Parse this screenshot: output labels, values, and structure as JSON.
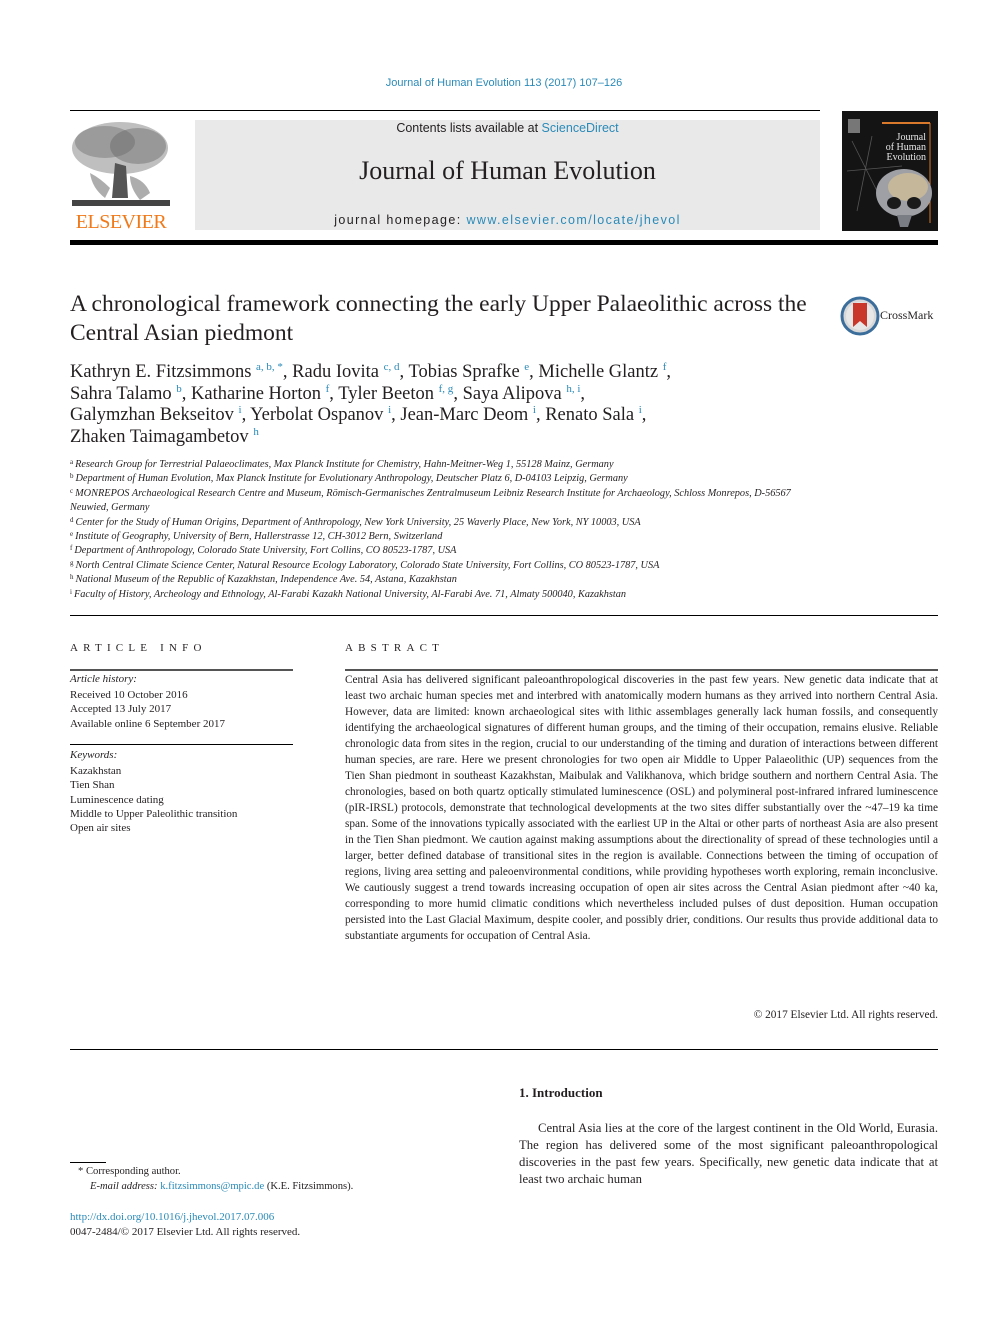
{
  "header": {
    "running_head": "Journal of Human Evolution 113 (2017) 107–126",
    "contents_prefix": "Contents lists available at ",
    "contents_link": "ScienceDirect",
    "journal_title": "Journal of Human Evolution",
    "homepage_prefix": "journal homepage: ",
    "homepage_link": "www.elsevier.com/locate/jhevol",
    "publisher_logo_text": "ELSEVIER",
    "cover_title_lines": [
      "Journal",
      "of Human",
      "Evolution"
    ],
    "colors": {
      "link": "#2a8ab8",
      "publisher": "#f07a1a",
      "masthead_bg": "#e9e9e9"
    }
  },
  "article": {
    "title": "A chronological framework connecting the early Upper Palaeolithic across the Central Asian piedmont",
    "crossmark_label": "CrossMark",
    "authors": [
      {
        "name": "Kathryn E. Fitzsimmons",
        "aff": "a, b, *",
        "sep": ", "
      },
      {
        "name": "Radu Iovita",
        "aff": "c, d",
        "sep": ", "
      },
      {
        "name": "Tobias Sprafke",
        "aff": "e",
        "sep": ", "
      },
      {
        "name": "Michelle Glantz",
        "aff": "f",
        "sep": ","
      },
      {
        "name": "Sahra Talamo",
        "aff": "b",
        "sep": ", "
      },
      {
        "name": "Katharine Horton",
        "aff": "f",
        "sep": ", "
      },
      {
        "name": "Tyler Beeton",
        "aff": "f, g",
        "sep": ", "
      },
      {
        "name": "Saya Alipova",
        "aff": "h, i",
        "sep": ","
      },
      {
        "name": "Galymzhan Bekseitov",
        "aff": "i",
        "sep": ", "
      },
      {
        "name": "Yerbolat Ospanov",
        "aff": "i",
        "sep": ", "
      },
      {
        "name": "Jean-Marc Deom",
        "aff": "i",
        "sep": ", "
      },
      {
        "name": "Renato Sala",
        "aff": "i",
        "sep": ","
      },
      {
        "name": "Zhaken Taimagambetov",
        "aff": "h",
        "sep": ""
      }
    ],
    "affiliations": [
      {
        "key": "a",
        "text": "Research Group for Terrestrial Palaeoclimates, Max Planck Institute for Chemistry, Hahn-Meitner-Weg 1, 55128 Mainz, Germany"
      },
      {
        "key": "b",
        "text": "Department of Human Evolution, Max Planck Institute for Evolutionary Anthropology, Deutscher Platz 6, D-04103 Leipzig, Germany"
      },
      {
        "key": "c",
        "text": "MONREPOS Archaeological Research Centre and Museum, Römisch-Germanisches Zentralmuseum Leibniz Research Institute for Archaeology, Schloss Monrepos, D-56567 Neuwied, Germany"
      },
      {
        "key": "d",
        "text": "Center for the Study of Human Origins, Department of Anthropology, New York University, 25 Waverly Place, New York, NY 10003, USA"
      },
      {
        "key": "e",
        "text": "Institute of Geography, University of Bern, Hallerstrasse 12, CH-3012 Bern, Switzerland"
      },
      {
        "key": "f",
        "text": "Department of Anthropology, Colorado State University, Fort Collins, CO 80523-1787, USA"
      },
      {
        "key": "g",
        "text": "North Central Climate Science Center, Natural Resource Ecology Laboratory, Colorado State University, Fort Collins, CO 80523-1787, USA"
      },
      {
        "key": "h",
        "text": "National Museum of the Republic of Kazakhstan, Independence Ave. 54, Astana, Kazakhstan"
      },
      {
        "key": "i",
        "text": "Faculty of History, Archeology and Ethnology, Al-Farabi Kazakh National University, Al-Farabi Ave. 71, Almaty 500040, Kazakhstan"
      }
    ]
  },
  "article_info": {
    "heading": "ARTICLE INFO",
    "history_label": "Article history:",
    "history": [
      "Received 10 October 2016",
      "Accepted 13 July 2017",
      "Available online 6 September 2017"
    ],
    "keywords_label": "Keywords:",
    "keywords": [
      "Kazakhstan",
      "Tien Shan",
      "Luminescence dating",
      "Middle to Upper Paleolithic transition",
      "Open air sites"
    ]
  },
  "abstract": {
    "heading": "ABSTRACT",
    "text": "Central Asia has delivered significant paleoanthropological discoveries in the past few years. New genetic data indicate that at least two archaic human species met and interbred with anatomically modern humans as they arrived into northern Central Asia. However, data are limited: known archaeological sites with lithic assemblages generally lack human fossils, and consequently identifying the archaeological signatures of different human groups, and the timing of their occupation, remains elusive. Reliable chronologic data from sites in the region, crucial to our understanding of the timing and duration of interactions between different human species, are rare. Here we present chronologies for two open air Middle to Upper Palaeolithic (UP) sequences from the Tien Shan piedmont in southeast Kazakhstan, Maibulak and Valikhanova, which bridge southern and northern Central Asia. The chronologies, based on both quartz optically stimulated luminescence (OSL) and polymineral post-infrared infrared luminescence (pIR-IRSL) protocols, demonstrate that technological developments at the two sites differ substantially over the ~47–19 ka time span. Some of the innovations typically associated with the earliest UP in the Altai or other parts of northeast Asia are also present in the Tien Shan piedmont. We caution against making assumptions about the directionality of spread of these technologies until a larger, better defined database of transitional sites in the region is available. Connections between the timing of occupation of regions, living area setting and paleoenvironmental conditions, while providing hypotheses worth exploring, remain inconclusive. We cautiously suggest a trend towards increasing occupation of open air sites across the Central Asian piedmont after ~40 ka, corresponding to more humid climatic conditions which nevertheless included pulses of dust deposition. Human occupation persisted into the Last Glacial Maximum, despite cooler, and possibly drier, conditions. Our results thus provide additional data to substantiate arguments for occupation of Central Asia.",
    "copyright": "© 2017 Elsevier Ltd. All rights reserved."
  },
  "introduction": {
    "heading": "1.  Introduction",
    "text": "Central Asia lies at the core of the largest continent in the Old World, Eurasia. The region has delivered some of the most significant paleoanthropological discoveries in the past few years. Specifically, new genetic data indicate that at least two archaic human"
  },
  "footnotes": {
    "corresponding_marker": "*",
    "corresponding_text": "Corresponding author.",
    "email_label": "E-mail address:",
    "email": "k.fitzsimmons@mpic.de",
    "email_owner": "(K.E. Fitzsimmons)."
  },
  "footer": {
    "doi": "http://dx.doi.org/10.1016/j.jhevol.2017.07.006",
    "issn_copyright": "0047-2484/© 2017 Elsevier Ltd. All rights reserved."
  }
}
